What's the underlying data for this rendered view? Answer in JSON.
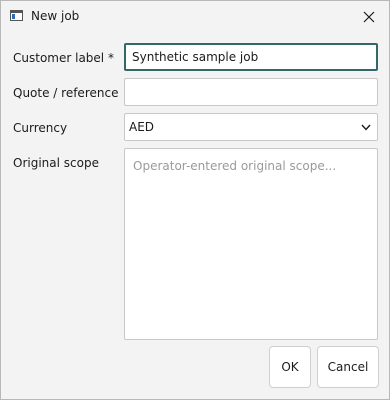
{
  "window": {
    "title": "New job",
    "app_icon": "window-app-icon",
    "close_icon": "close-icon"
  },
  "form": {
    "customer_label": {
      "label": "Customer label *",
      "value": "Synthetic sample job"
    },
    "quote_reference": {
      "label": "Quote / reference",
      "value": ""
    },
    "currency": {
      "label": "Currency",
      "value": "AED",
      "icon": "chevron-down-icon"
    },
    "original_scope": {
      "label": "Original scope",
      "placeholder": "Operator-entered original scope..."
    }
  },
  "buttons": {
    "ok": "OK",
    "cancel": "Cancel"
  },
  "colors": {
    "focus_border": "#33686a",
    "window_bg": "#f3f3f3",
    "field_bg": "#ffffff",
    "placeholder": "#9a9a9a"
  }
}
